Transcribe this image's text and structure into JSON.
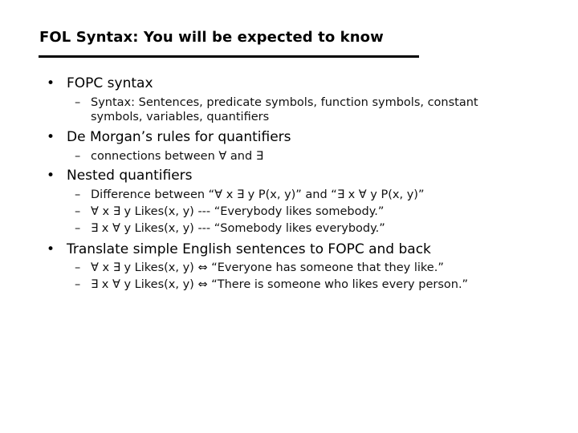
{
  "slide": {
    "title": "FOL Syntax: You will be expected to know",
    "bullet_glyph": "•",
    "dash_glyph": "–",
    "items": [
      {
        "label": "FOPC syntax",
        "subitems": [
          {
            "line1": "Syntax: Sentences, predicate symbols, function symbols, constant",
            "line2": "symbols, variables, quantifiers"
          }
        ]
      },
      {
        "label": "De Morgan’s rules for quantifiers",
        "subitems": [
          {
            "line1": "connections between ∀ and ∃"
          }
        ]
      },
      {
        "label": "Nested quantifiers",
        "subitems": [
          {
            "line1": "Difference between “∀ x ∃ y P(x, y)” and “∃ x ∀ y P(x, y)”"
          },
          {
            "line1": "∀ x ∃ y Likes(x, y) --- “Everybody likes somebody.”"
          },
          {
            "line1": "∃ x ∀ y Likes(x, y) --- “Somebody likes everybody.”"
          }
        ]
      },
      {
        "label": "Translate simple English sentences to FOPC and back",
        "subitems": [
          {
            "line1": "∀ x ∃ y Likes(x, y) ⇔ “Everyone has someone that they like.”"
          },
          {
            "line1": "∃ x ∀ y Likes(x, y) ⇔ “There is someone who likes every person.”"
          }
        ]
      }
    ]
  }
}
